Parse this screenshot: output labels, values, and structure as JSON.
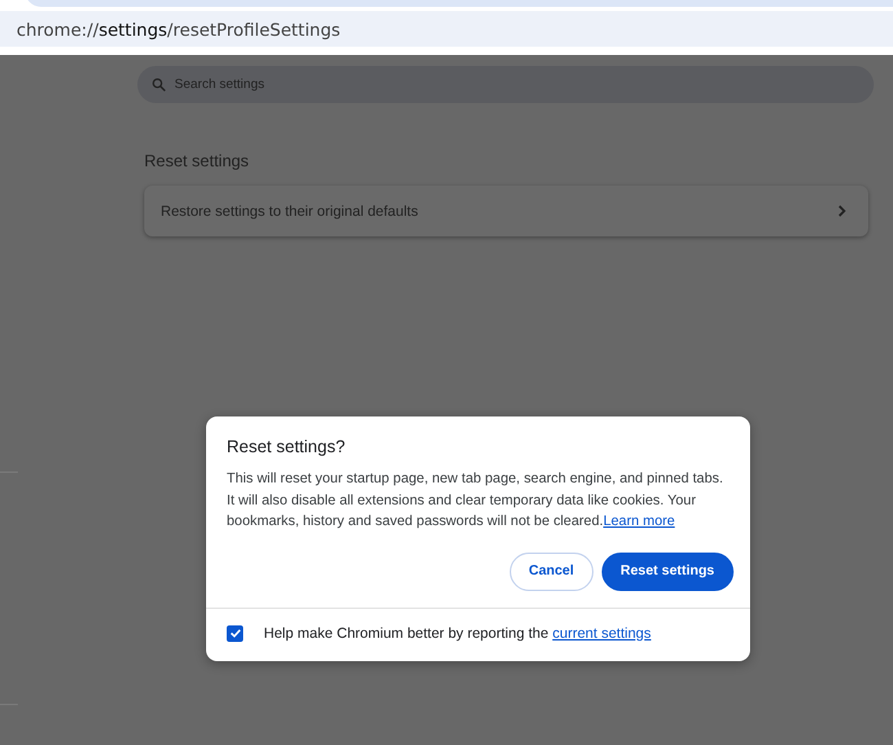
{
  "address_bar": {
    "url_prefix": "chrome://",
    "url_highlight": "settings",
    "url_rest": "/resetProfileSettings"
  },
  "search": {
    "placeholder": "Search settings"
  },
  "section": {
    "title": "Reset settings",
    "row": "Restore settings to their original defaults"
  },
  "dialog": {
    "title": "Reset settings?",
    "body": "This will reset your startup page, new tab page, search engine, and pinned tabs. It will also disable all extensions and clear temporary data like cookies. Your bookmarks, history and saved passwords will not be cleared.",
    "link": "Learn more",
    "buttons": [
      {
        "label": "Cancel",
        "kind": "secondary"
      },
      {
        "label": "Reset settings",
        "kind": "primary"
      }
    ],
    "footer": {
      "checked": true,
      "text": "Help make Chromium better by reporting the",
      "link": "current settings"
    }
  }
}
